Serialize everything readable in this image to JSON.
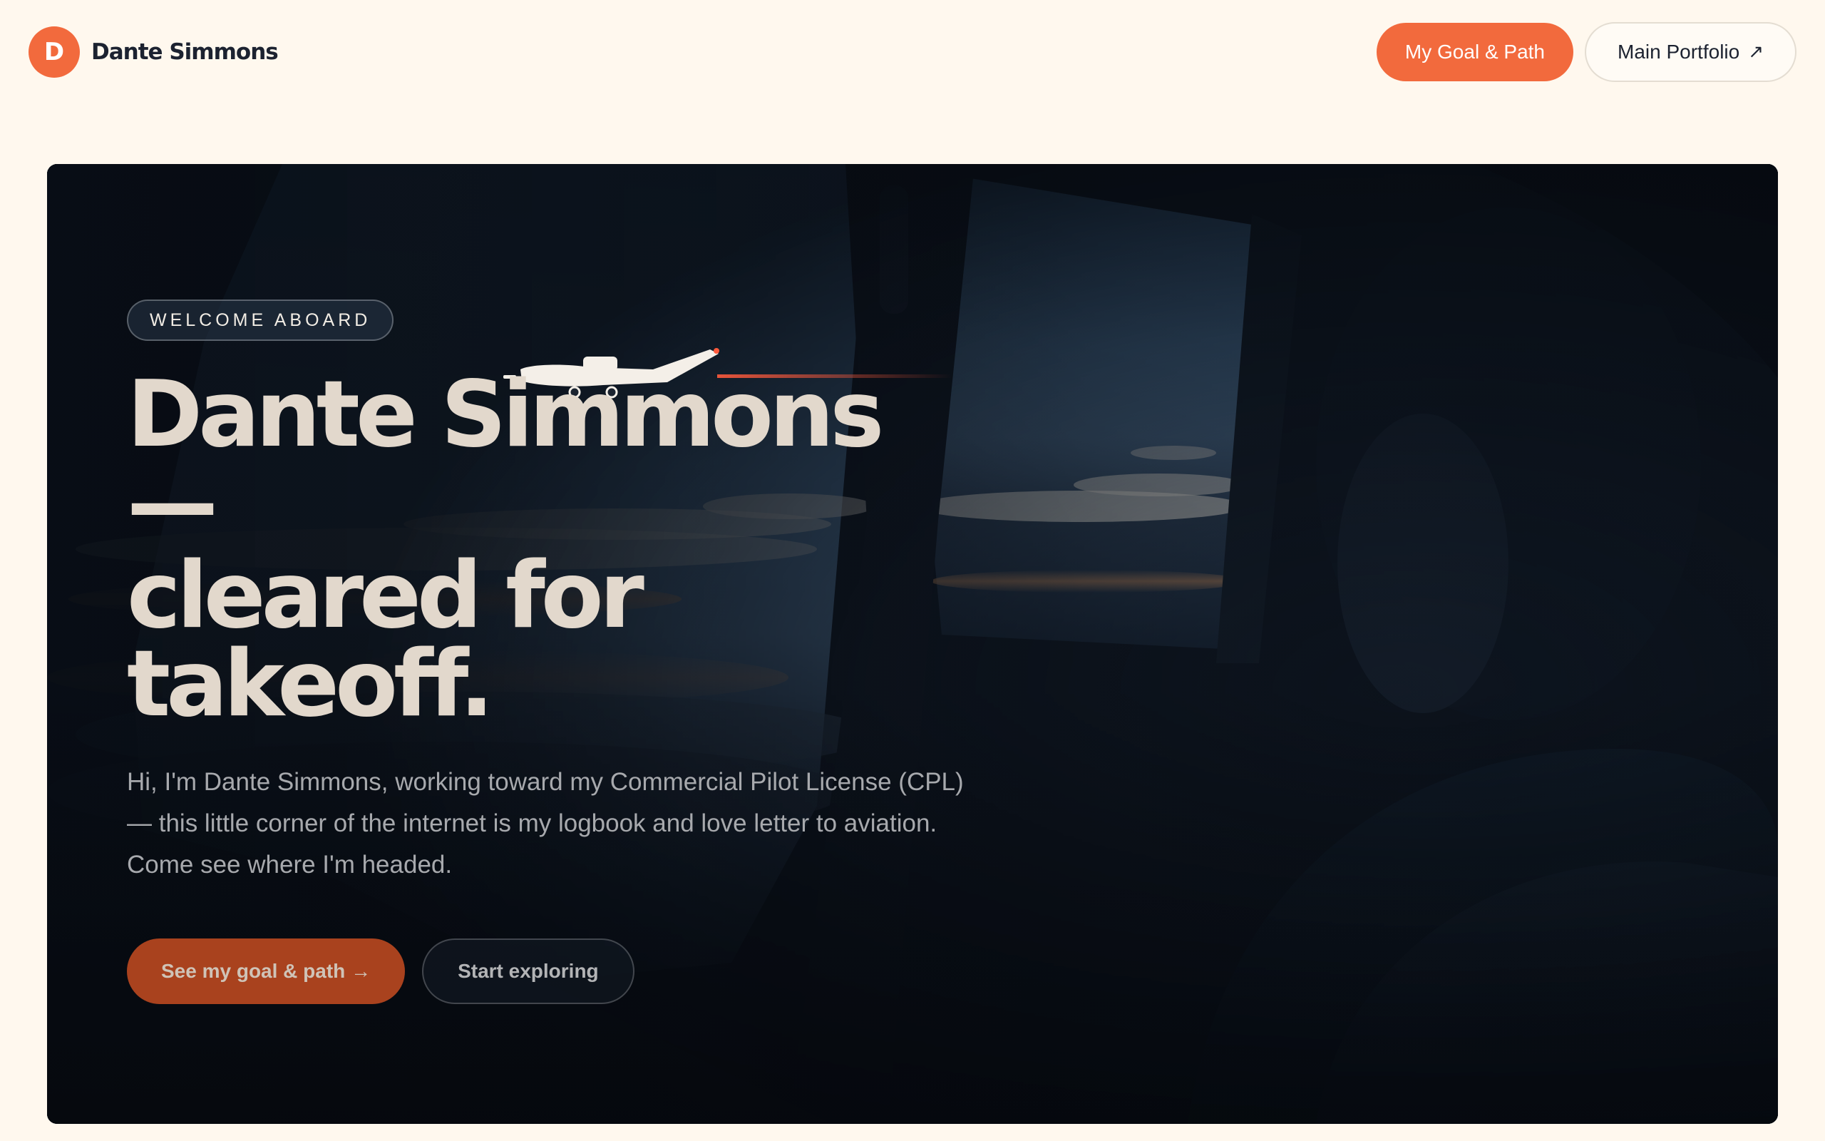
{
  "header": {
    "logo_letter": "D",
    "brand_name": "Dante Simmons",
    "nav_goal_label": "My Goal & Path",
    "nav_portfolio_label": "Main Portfolio",
    "nav_portfolio_icon": "↗"
  },
  "hero": {
    "eyebrow": "WELCOME ABOARD",
    "headline_line1": "Dante Simmons",
    "headline_line2": "—",
    "headline_line3": "cleared for",
    "headline_line4": "takeoff.",
    "intro_line1": "Hi, I'm Dante Simmons, working toward my Commercial Pilot License (CPL)",
    "intro_line2": "— this little corner of the internet is my logbook and love letter to aviation.",
    "intro_line3": "Come see where I'm headed.",
    "cta_primary": "See my goal & path →",
    "cta_secondary": "Start exploring"
  },
  "colors": {
    "accent": "#f26a3d",
    "page_bg": "#fff8ee",
    "ink": "#1c2230"
  }
}
